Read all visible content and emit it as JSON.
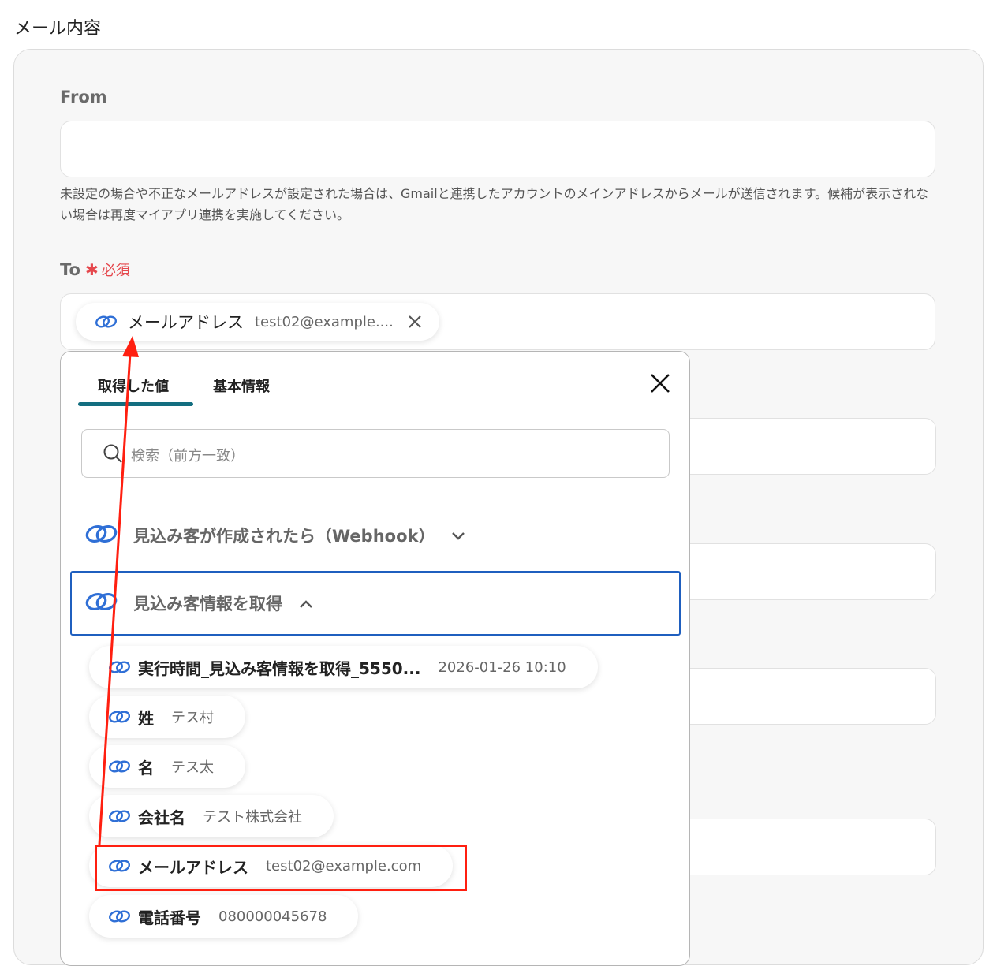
{
  "section_title": "メール内容",
  "from": {
    "label": "From",
    "value": "",
    "help": "未設定の場合や不正なメールアドレスが設定された場合は、Gmailと連携したアカウントのメインアドレスからメールが送信されます。候補が表示されない場合は再度マイアプリ連携を実施してください。"
  },
  "to": {
    "label": "To",
    "required_mark": "✱",
    "required_text": "必須",
    "chip": {
      "key": "メールアドレス",
      "value": "test02@example...."
    }
  },
  "popup": {
    "tabs": [
      "取得した値",
      "基本情報"
    ],
    "search_placeholder": "検索（前方一致）",
    "groups": [
      {
        "label": "見込み客が作成されたら（Webhook）",
        "state": "collapsed"
      },
      {
        "label": "見込み客情報を取得",
        "state": "expanded"
      }
    ],
    "items": [
      {
        "key": "実行時間_見込み客情報を取得_5550...",
        "value": "2026-01-26 10:10"
      },
      {
        "key": "姓",
        "value": "テス村"
      },
      {
        "key": "名",
        "value": "テス太"
      },
      {
        "key": "会社名",
        "value": "テスト株式会社"
      },
      {
        "key": "メールアドレス",
        "value": "test02@example.com"
      },
      {
        "key": "電話番号",
        "value": "080000045678"
      }
    ]
  },
  "colors": {
    "accent_tab": "#136e80",
    "required": "#e5484d",
    "selection_border": "#1f5fbf",
    "annotation_red": "#ff1f10",
    "link_icon_blue": "#2f6fd6"
  }
}
